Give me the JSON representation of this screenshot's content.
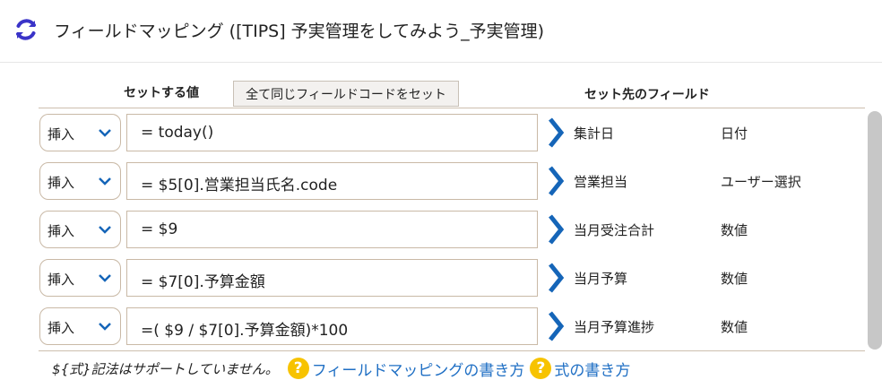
{
  "header": {
    "title": "フィールドマッピング ([TIPS] 予実管理をしてみよう_予実管理)",
    "refresh_icon": "refresh-icon",
    "accent_color": "#3a33c8"
  },
  "columns": {
    "set_value": "セットする値",
    "same_code_button": "全て同じフィールドコードをセット",
    "target_field": "セット先のフィールド"
  },
  "rows": [
    {
      "mode": "挿入",
      "expression": "= today()",
      "field": "集計日",
      "type": "日付"
    },
    {
      "mode": "挿入",
      "expression": "= $5[0].営業担当氏名.code",
      "field": "営業担当",
      "type": "ユーザー選択"
    },
    {
      "mode": "挿入",
      "expression": "= $9",
      "field": "当月受注合計",
      "type": "数値"
    },
    {
      "mode": "挿入",
      "expression": "= $7[0].予算金額",
      "field": "当月予算",
      "type": "数値"
    },
    {
      "mode": "挿入",
      "expression": "=( $9 / $7[0].予算金額)*100",
      "field": "当月予算進捗",
      "type": "数値"
    }
  ],
  "footer": {
    "note": "${式}記法はサポートしていません。",
    "help_mapping": "フィールドマッピングの書き方",
    "help_expression": "式の書き方",
    "help_icon_glyph": "?"
  },
  "colors": {
    "arrow": "#1565b8",
    "chevron": "#1565b8",
    "link": "#1f6fc4",
    "help_icon": "#f7c300"
  }
}
